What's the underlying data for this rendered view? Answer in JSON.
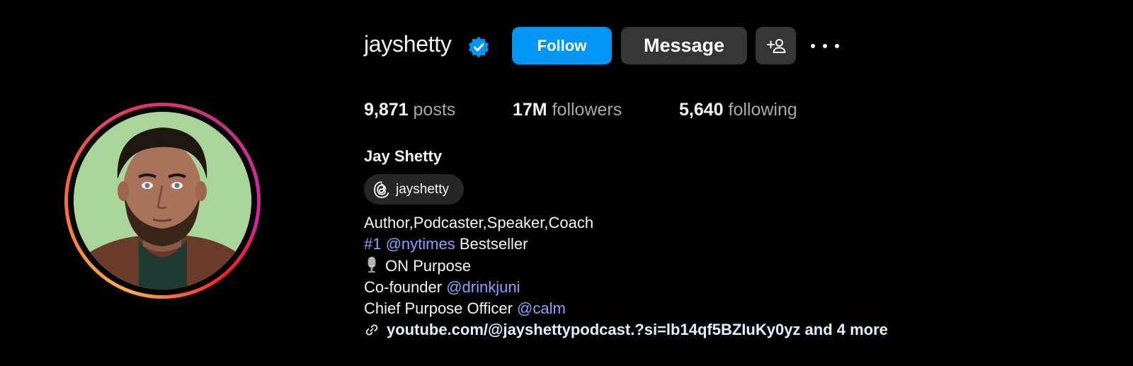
{
  "profile": {
    "username": "jayshetty",
    "verified": true,
    "full_name": "Jay Shetty",
    "threads_handle": "jayshetty"
  },
  "actions": {
    "follow_label": "Follow",
    "message_label": "Message"
  },
  "stats": {
    "posts": {
      "value": "9,871",
      "label": "posts"
    },
    "followers": {
      "value": "17M",
      "label": "followers"
    },
    "following": {
      "value": "5,640",
      "label": "following"
    }
  },
  "bio": {
    "line1": "Author,Podcaster,Speaker,Coach",
    "line2_prefix": "#1 @nytimes",
    "line2_suffix": " Bestseller",
    "line3": "ON Purpose",
    "line4_text": "Co-founder ",
    "line4_mention": "@drinkjuni",
    "line5_text": "Chief Purpose Officer ",
    "line5_mention": "@calm"
  },
  "website": {
    "url_text": "youtube.com/@jayshettypodcast.?si=lb14qf5BZIuKy0yz and 4 more"
  },
  "colors": {
    "background": "#000000",
    "follow_button": "#0095f6",
    "secondary_button": "#363636",
    "mention_link": "#8da0ff",
    "verified_badge": "#0095f6"
  },
  "icons": {
    "verified": "verified-badge-icon",
    "suggest": "add-person-icon",
    "more": "more-options-icon",
    "threads": "threads-icon",
    "mic": "microphone-icon",
    "link": "link-icon"
  }
}
